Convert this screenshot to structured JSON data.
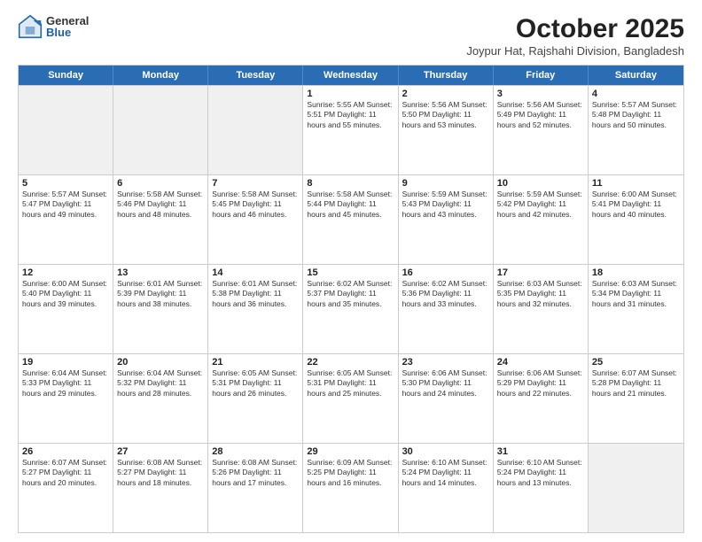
{
  "logo": {
    "general": "General",
    "blue": "Blue"
  },
  "header": {
    "month": "October 2025",
    "location": "Joypur Hat, Rajshahi Division, Bangladesh"
  },
  "days": [
    "Sunday",
    "Monday",
    "Tuesday",
    "Wednesday",
    "Thursday",
    "Friday",
    "Saturday"
  ],
  "weeks": [
    [
      {
        "day": "",
        "content": ""
      },
      {
        "day": "",
        "content": ""
      },
      {
        "day": "",
        "content": ""
      },
      {
        "day": "1",
        "content": "Sunrise: 5:55 AM\nSunset: 5:51 PM\nDaylight: 11 hours\nand 55 minutes."
      },
      {
        "day": "2",
        "content": "Sunrise: 5:56 AM\nSunset: 5:50 PM\nDaylight: 11 hours\nand 53 minutes."
      },
      {
        "day": "3",
        "content": "Sunrise: 5:56 AM\nSunset: 5:49 PM\nDaylight: 11 hours\nand 52 minutes."
      },
      {
        "day": "4",
        "content": "Sunrise: 5:57 AM\nSunset: 5:48 PM\nDaylight: 11 hours\nand 50 minutes."
      }
    ],
    [
      {
        "day": "5",
        "content": "Sunrise: 5:57 AM\nSunset: 5:47 PM\nDaylight: 11 hours\nand 49 minutes."
      },
      {
        "day": "6",
        "content": "Sunrise: 5:58 AM\nSunset: 5:46 PM\nDaylight: 11 hours\nand 48 minutes."
      },
      {
        "day": "7",
        "content": "Sunrise: 5:58 AM\nSunset: 5:45 PM\nDaylight: 11 hours\nand 46 minutes."
      },
      {
        "day": "8",
        "content": "Sunrise: 5:58 AM\nSunset: 5:44 PM\nDaylight: 11 hours\nand 45 minutes."
      },
      {
        "day": "9",
        "content": "Sunrise: 5:59 AM\nSunset: 5:43 PM\nDaylight: 11 hours\nand 43 minutes."
      },
      {
        "day": "10",
        "content": "Sunrise: 5:59 AM\nSunset: 5:42 PM\nDaylight: 11 hours\nand 42 minutes."
      },
      {
        "day": "11",
        "content": "Sunrise: 6:00 AM\nSunset: 5:41 PM\nDaylight: 11 hours\nand 40 minutes."
      }
    ],
    [
      {
        "day": "12",
        "content": "Sunrise: 6:00 AM\nSunset: 5:40 PM\nDaylight: 11 hours\nand 39 minutes."
      },
      {
        "day": "13",
        "content": "Sunrise: 6:01 AM\nSunset: 5:39 PM\nDaylight: 11 hours\nand 38 minutes."
      },
      {
        "day": "14",
        "content": "Sunrise: 6:01 AM\nSunset: 5:38 PM\nDaylight: 11 hours\nand 36 minutes."
      },
      {
        "day": "15",
        "content": "Sunrise: 6:02 AM\nSunset: 5:37 PM\nDaylight: 11 hours\nand 35 minutes."
      },
      {
        "day": "16",
        "content": "Sunrise: 6:02 AM\nSunset: 5:36 PM\nDaylight: 11 hours\nand 33 minutes."
      },
      {
        "day": "17",
        "content": "Sunrise: 6:03 AM\nSunset: 5:35 PM\nDaylight: 11 hours\nand 32 minutes."
      },
      {
        "day": "18",
        "content": "Sunrise: 6:03 AM\nSunset: 5:34 PM\nDaylight: 11 hours\nand 31 minutes."
      }
    ],
    [
      {
        "day": "19",
        "content": "Sunrise: 6:04 AM\nSunset: 5:33 PM\nDaylight: 11 hours\nand 29 minutes."
      },
      {
        "day": "20",
        "content": "Sunrise: 6:04 AM\nSunset: 5:32 PM\nDaylight: 11 hours\nand 28 minutes."
      },
      {
        "day": "21",
        "content": "Sunrise: 6:05 AM\nSunset: 5:31 PM\nDaylight: 11 hours\nand 26 minutes."
      },
      {
        "day": "22",
        "content": "Sunrise: 6:05 AM\nSunset: 5:31 PM\nDaylight: 11 hours\nand 25 minutes."
      },
      {
        "day": "23",
        "content": "Sunrise: 6:06 AM\nSunset: 5:30 PM\nDaylight: 11 hours\nand 24 minutes."
      },
      {
        "day": "24",
        "content": "Sunrise: 6:06 AM\nSunset: 5:29 PM\nDaylight: 11 hours\nand 22 minutes."
      },
      {
        "day": "25",
        "content": "Sunrise: 6:07 AM\nSunset: 5:28 PM\nDaylight: 11 hours\nand 21 minutes."
      }
    ],
    [
      {
        "day": "26",
        "content": "Sunrise: 6:07 AM\nSunset: 5:27 PM\nDaylight: 11 hours\nand 20 minutes."
      },
      {
        "day": "27",
        "content": "Sunrise: 6:08 AM\nSunset: 5:27 PM\nDaylight: 11 hours\nand 18 minutes."
      },
      {
        "day": "28",
        "content": "Sunrise: 6:08 AM\nSunset: 5:26 PM\nDaylight: 11 hours\nand 17 minutes."
      },
      {
        "day": "29",
        "content": "Sunrise: 6:09 AM\nSunset: 5:25 PM\nDaylight: 11 hours\nand 16 minutes."
      },
      {
        "day": "30",
        "content": "Sunrise: 6:10 AM\nSunset: 5:24 PM\nDaylight: 11 hours\nand 14 minutes."
      },
      {
        "day": "31",
        "content": "Sunrise: 6:10 AM\nSunset: 5:24 PM\nDaylight: 11 hours\nand 13 minutes."
      },
      {
        "day": "",
        "content": ""
      }
    ]
  ]
}
